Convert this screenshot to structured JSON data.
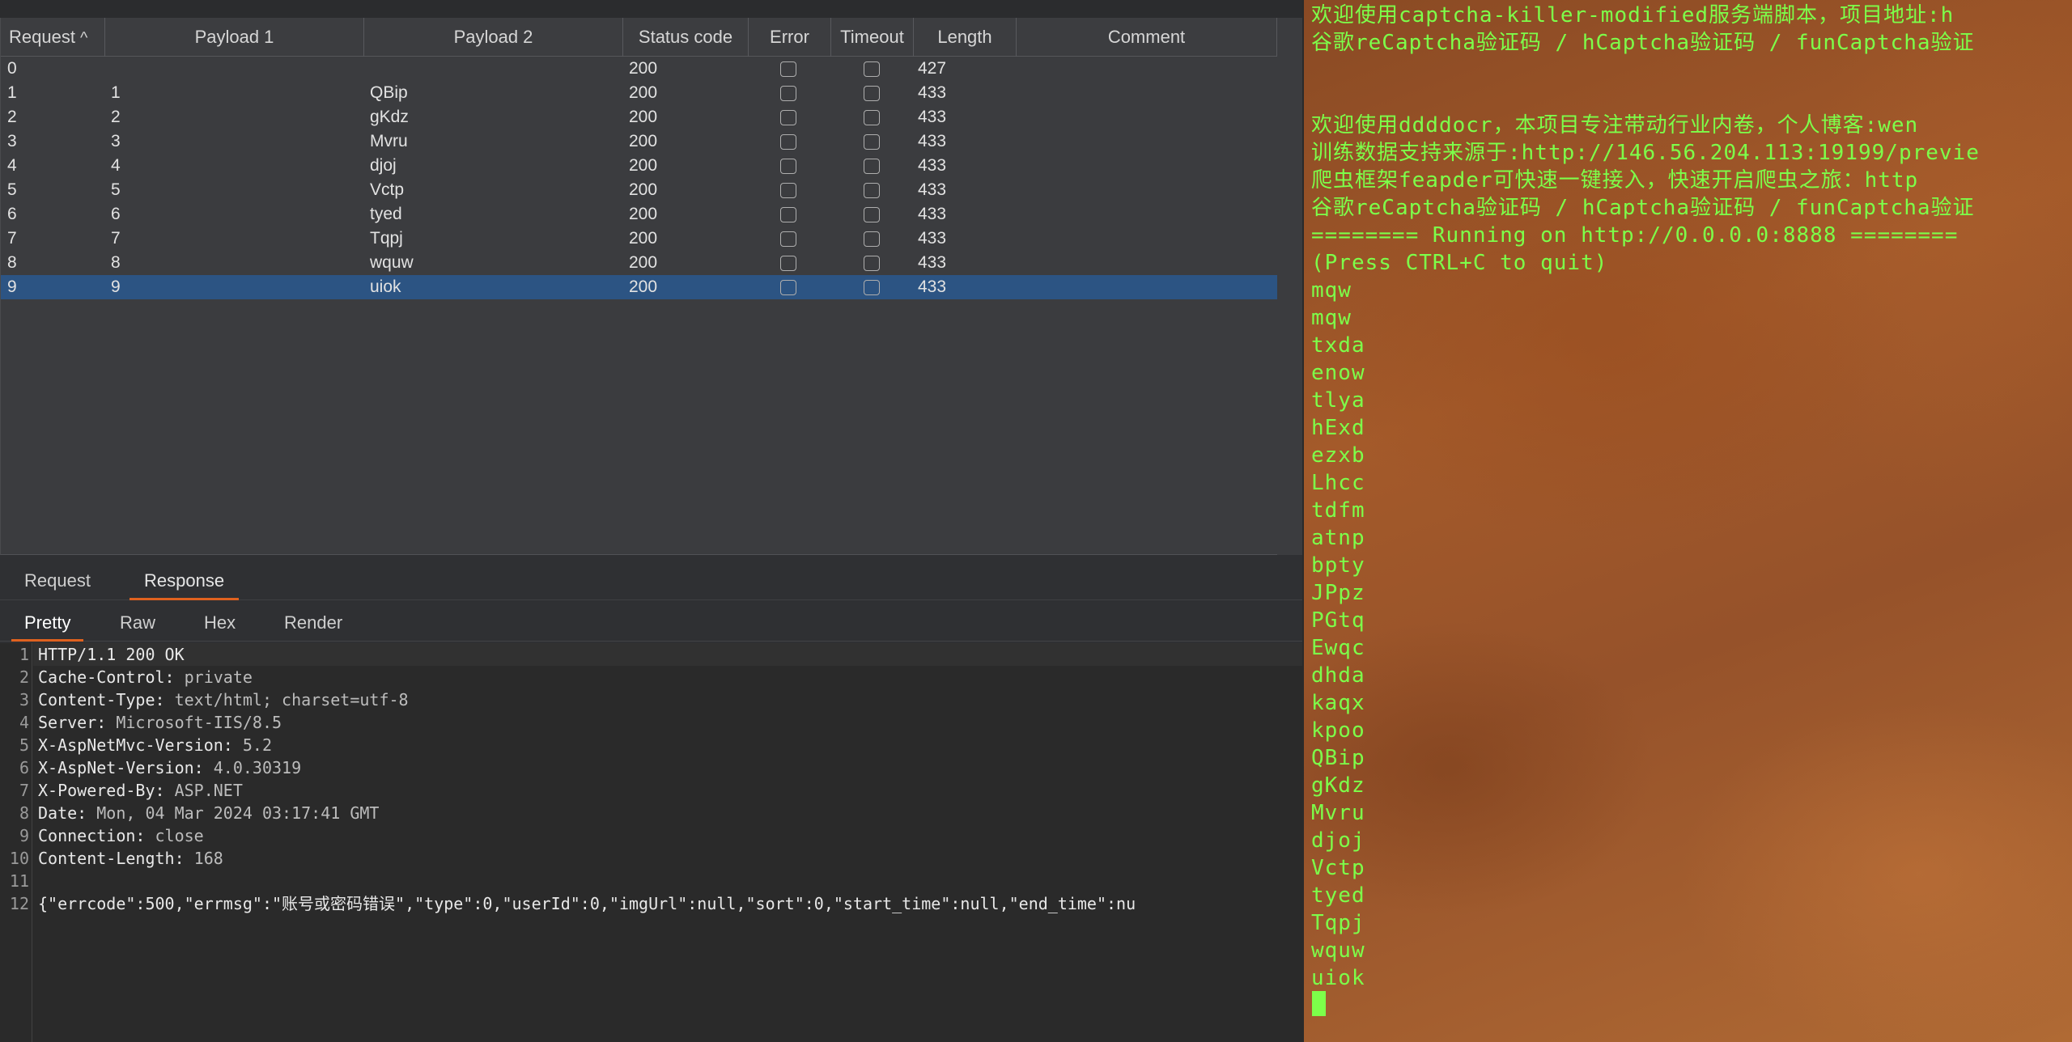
{
  "results_table": {
    "columns": [
      "Request",
      "Payload 1",
      "Payload 2",
      "Status code",
      "Error",
      "Timeout",
      "Length",
      "Comment"
    ],
    "sort_indicator": "^",
    "rows": [
      {
        "request": "0",
        "payload1": "",
        "payload2": "",
        "status": "200",
        "length": "427",
        "selected": false
      },
      {
        "request": "1",
        "payload1": "1",
        "payload2": "QBip",
        "status": "200",
        "length": "433",
        "selected": false
      },
      {
        "request": "2",
        "payload1": "2",
        "payload2": "gKdz",
        "status": "200",
        "length": "433",
        "selected": false
      },
      {
        "request": "3",
        "payload1": "3",
        "payload2": "Mvru",
        "status": "200",
        "length": "433",
        "selected": false
      },
      {
        "request": "4",
        "payload1": "4",
        "payload2": "djoj",
        "status": "200",
        "length": "433",
        "selected": false
      },
      {
        "request": "5",
        "payload1": "5",
        "payload2": "Vctp",
        "status": "200",
        "length": "433",
        "selected": false
      },
      {
        "request": "6",
        "payload1": "6",
        "payload2": "tyed",
        "status": "200",
        "length": "433",
        "selected": false
      },
      {
        "request": "7",
        "payload1": "7",
        "payload2": "Tqpj",
        "status": "200",
        "length": "433",
        "selected": false
      },
      {
        "request": "8",
        "payload1": "8",
        "payload2": "wquw",
        "status": "200",
        "length": "433",
        "selected": false
      },
      {
        "request": "9",
        "payload1": "9",
        "payload2": "uiok",
        "status": "200",
        "length": "433",
        "selected": true
      }
    ]
  },
  "message_tabs": [
    {
      "label": "Request",
      "active": false
    },
    {
      "label": "Response",
      "active": true
    }
  ],
  "view_tabs": [
    {
      "label": "Pretty",
      "active": true
    },
    {
      "label": "Raw",
      "active": false
    },
    {
      "label": "Hex",
      "active": false
    },
    {
      "label": "Render",
      "active": false
    }
  ],
  "response_lines": [
    {
      "num": "1",
      "key": "HTTP/1.1 200 OK",
      "value": ""
    },
    {
      "num": "2",
      "key": "Cache-Control:",
      "value": " private"
    },
    {
      "num": "3",
      "key": "Content-Type:",
      "value": " text/html; charset=utf-8"
    },
    {
      "num": "4",
      "key": "Server:",
      "value": " Microsoft-IIS/8.5"
    },
    {
      "num": "5",
      "key": "X-AspNetMvc-Version:",
      "value": " 5.2"
    },
    {
      "num": "6",
      "key": "X-AspNet-Version:",
      "value": " 4.0.30319"
    },
    {
      "num": "7",
      "key": "X-Powered-By:",
      "value": " ASP.NET"
    },
    {
      "num": "8",
      "key": "Date:",
      "value": " Mon, 04 Mar 2024 03:17:41 GMT"
    },
    {
      "num": "9",
      "key": "Connection:",
      "value": " close"
    },
    {
      "num": "10",
      "key": "Content-Length:",
      "value": " 168"
    },
    {
      "num": "11",
      "key": "",
      "value": ""
    },
    {
      "num": "12",
      "key": "{\"errcode\":500,\"errmsg\":\"账号或密码错误\",\"type\":0,\"userId\":0,\"imgUrl\":null,\"sort\":0,\"start_time\":null,\"end_time\":nu",
      "value": ""
    }
  ],
  "terminal_lines": [
    "欢迎使用captcha-killer-modified服务端脚本，项目地址:h",
    "谷歌reCaptcha验证码 / hCaptcha验证码 / funCaptcha验证",
    "",
    "",
    "欢迎使用ddddocr，本项目专注带动行业内卷，个人博客:wen",
    "训练数据支持来源于:http://146.56.204.113:19199/previe",
    "爬虫框架feapder可快速一键接入，快速开启爬虫之旅：http",
    "谷歌reCaptcha验证码 / hCaptcha验证码 / funCaptcha验证",
    "======== Running on http://0.0.0.0:8888 ========",
    "(Press CTRL+C to quit)",
    "mqw",
    "mqw",
    "txda",
    "enow",
    "tlya",
    "hExd",
    "ezxb",
    "Lhcc",
    "tdfm",
    "atnp",
    "bpty",
    "JPpz",
    "PGtq",
    "Ewqc",
    "dhda",
    "kaqx",
    "kpoo",
    "QBip",
    "gKdz",
    "Mvru",
    "djoj",
    "Vctp",
    "tyed",
    "Tqpj",
    "wquw",
    "uiok"
  ],
  "colors": {
    "terminal_text": "#7dff4a",
    "selected_row": "#2c5483",
    "active_tab_underline": "#e0621f"
  }
}
